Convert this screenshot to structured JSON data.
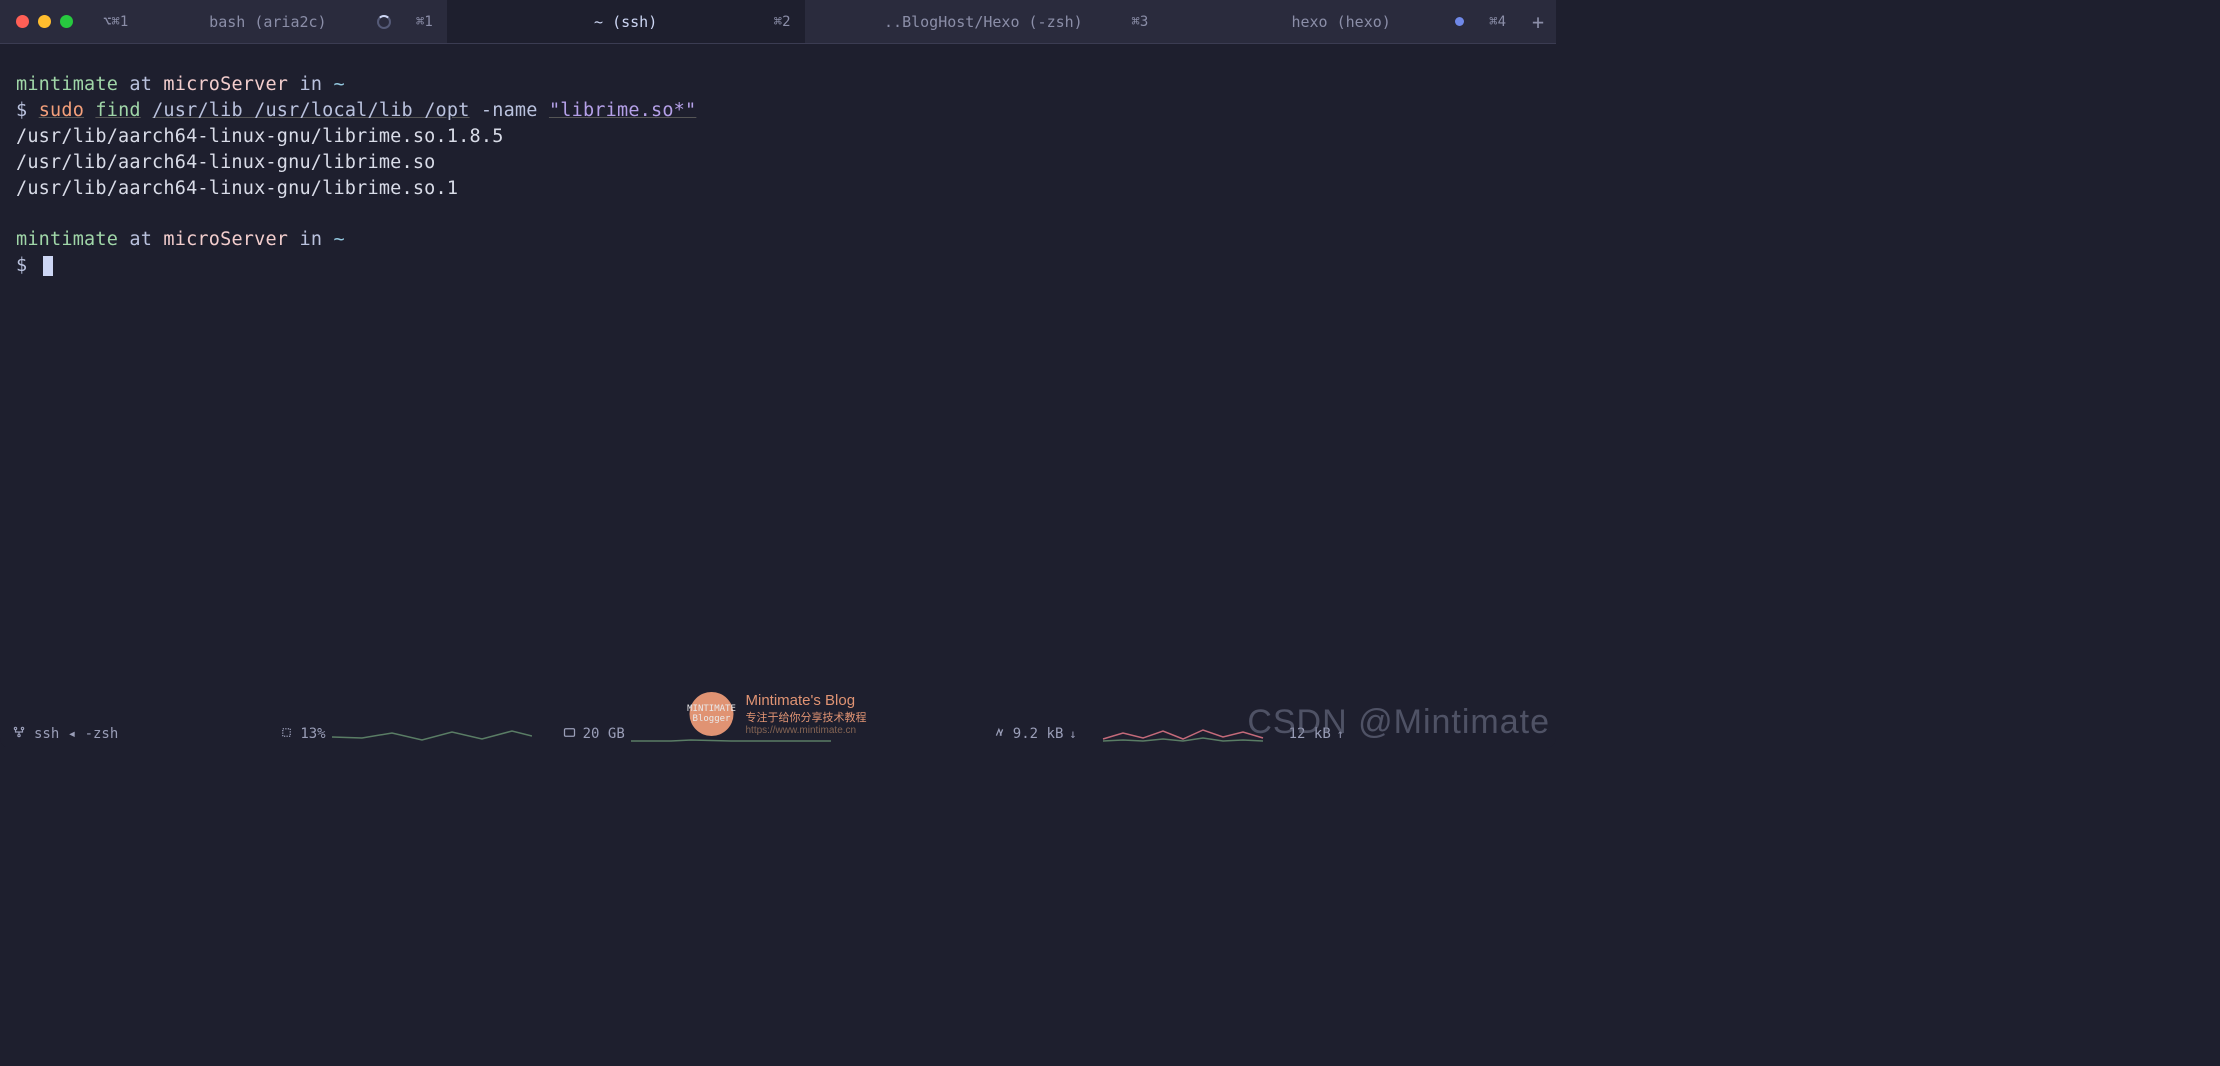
{
  "tabs": [
    {
      "title": "bash (aria2c)",
      "shortcut": "⌘1",
      "left_icon": "⌥⌘1",
      "has_spinner": true
    },
    {
      "title": "~ (ssh)",
      "shortcut": "⌘2",
      "active": true
    },
    {
      "title": "..BlogHost/Hexo (-zsh)",
      "shortcut": "⌘3"
    },
    {
      "title": "hexo (hexo)",
      "shortcut": "⌘4",
      "has_dot": true
    }
  ],
  "prompt1": {
    "user": "mintimate",
    "at": "at",
    "host": "microServer",
    "in": "in",
    "path": "~",
    "ps": "$",
    "cmd1": "sudo",
    "cmd2": "find",
    "args": "/usr/lib /usr/local/lib /opt",
    "flag": "-name",
    "str": "\"librime.so*\""
  },
  "output": [
    "/usr/lib/aarch64-linux-gnu/librime.so.1.8.5",
    "/usr/lib/aarch64-linux-gnu/librime.so",
    "/usr/lib/aarch64-linux-gnu/librime.so.1"
  ],
  "prompt2": {
    "user": "mintimate",
    "at": "at",
    "host": "microServer",
    "in": "in",
    "path": "~",
    "ps": "$"
  },
  "status": {
    "session": "ssh ◂ -zsh",
    "cpu": "13%",
    "disk": "20 GB",
    "net_down": "9.2 kB",
    "net_up": "12 kB"
  },
  "blog": {
    "title": "Mintimate's Blog",
    "subtitle": "专注于给你分享技术教程",
    "url": "https://www.mintimate.cn"
  },
  "watermark": "CSDN @Mintimate"
}
